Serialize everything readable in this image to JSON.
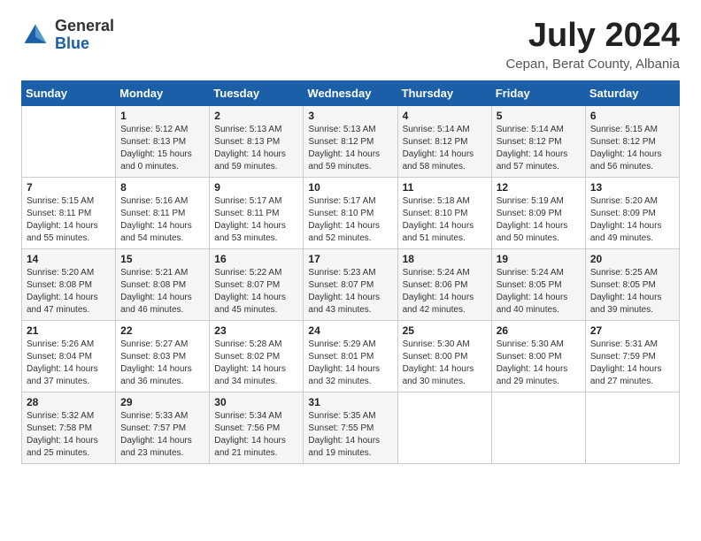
{
  "logo": {
    "general": "General",
    "blue": "Blue"
  },
  "title": {
    "month_year": "July 2024",
    "location": "Cepan, Berat County, Albania"
  },
  "weekdays": [
    "Sunday",
    "Monday",
    "Tuesday",
    "Wednesday",
    "Thursday",
    "Friday",
    "Saturday"
  ],
  "weeks": [
    [
      {
        "day": "",
        "info": ""
      },
      {
        "day": "1",
        "info": "Sunrise: 5:12 AM\nSunset: 8:13 PM\nDaylight: 15 hours\nand 0 minutes."
      },
      {
        "day": "2",
        "info": "Sunrise: 5:13 AM\nSunset: 8:13 PM\nDaylight: 14 hours\nand 59 minutes."
      },
      {
        "day": "3",
        "info": "Sunrise: 5:13 AM\nSunset: 8:12 PM\nDaylight: 14 hours\nand 59 minutes."
      },
      {
        "day": "4",
        "info": "Sunrise: 5:14 AM\nSunset: 8:12 PM\nDaylight: 14 hours\nand 58 minutes."
      },
      {
        "day": "5",
        "info": "Sunrise: 5:14 AM\nSunset: 8:12 PM\nDaylight: 14 hours\nand 57 minutes."
      },
      {
        "day": "6",
        "info": "Sunrise: 5:15 AM\nSunset: 8:12 PM\nDaylight: 14 hours\nand 56 minutes."
      }
    ],
    [
      {
        "day": "7",
        "info": "Sunrise: 5:15 AM\nSunset: 8:11 PM\nDaylight: 14 hours\nand 55 minutes."
      },
      {
        "day": "8",
        "info": "Sunrise: 5:16 AM\nSunset: 8:11 PM\nDaylight: 14 hours\nand 54 minutes."
      },
      {
        "day": "9",
        "info": "Sunrise: 5:17 AM\nSunset: 8:11 PM\nDaylight: 14 hours\nand 53 minutes."
      },
      {
        "day": "10",
        "info": "Sunrise: 5:17 AM\nSunset: 8:10 PM\nDaylight: 14 hours\nand 52 minutes."
      },
      {
        "day": "11",
        "info": "Sunrise: 5:18 AM\nSunset: 8:10 PM\nDaylight: 14 hours\nand 51 minutes."
      },
      {
        "day": "12",
        "info": "Sunrise: 5:19 AM\nSunset: 8:09 PM\nDaylight: 14 hours\nand 50 minutes."
      },
      {
        "day": "13",
        "info": "Sunrise: 5:20 AM\nSunset: 8:09 PM\nDaylight: 14 hours\nand 49 minutes."
      }
    ],
    [
      {
        "day": "14",
        "info": "Sunrise: 5:20 AM\nSunset: 8:08 PM\nDaylight: 14 hours\nand 47 minutes."
      },
      {
        "day": "15",
        "info": "Sunrise: 5:21 AM\nSunset: 8:08 PM\nDaylight: 14 hours\nand 46 minutes."
      },
      {
        "day": "16",
        "info": "Sunrise: 5:22 AM\nSunset: 8:07 PM\nDaylight: 14 hours\nand 45 minutes."
      },
      {
        "day": "17",
        "info": "Sunrise: 5:23 AM\nSunset: 8:07 PM\nDaylight: 14 hours\nand 43 minutes."
      },
      {
        "day": "18",
        "info": "Sunrise: 5:24 AM\nSunset: 8:06 PM\nDaylight: 14 hours\nand 42 minutes."
      },
      {
        "day": "19",
        "info": "Sunrise: 5:24 AM\nSunset: 8:05 PM\nDaylight: 14 hours\nand 40 minutes."
      },
      {
        "day": "20",
        "info": "Sunrise: 5:25 AM\nSunset: 8:05 PM\nDaylight: 14 hours\nand 39 minutes."
      }
    ],
    [
      {
        "day": "21",
        "info": "Sunrise: 5:26 AM\nSunset: 8:04 PM\nDaylight: 14 hours\nand 37 minutes."
      },
      {
        "day": "22",
        "info": "Sunrise: 5:27 AM\nSunset: 8:03 PM\nDaylight: 14 hours\nand 36 minutes."
      },
      {
        "day": "23",
        "info": "Sunrise: 5:28 AM\nSunset: 8:02 PM\nDaylight: 14 hours\nand 34 minutes."
      },
      {
        "day": "24",
        "info": "Sunrise: 5:29 AM\nSunset: 8:01 PM\nDaylight: 14 hours\nand 32 minutes."
      },
      {
        "day": "25",
        "info": "Sunrise: 5:30 AM\nSunset: 8:00 PM\nDaylight: 14 hours\nand 30 minutes."
      },
      {
        "day": "26",
        "info": "Sunrise: 5:30 AM\nSunset: 8:00 PM\nDaylight: 14 hours\nand 29 minutes."
      },
      {
        "day": "27",
        "info": "Sunrise: 5:31 AM\nSunset: 7:59 PM\nDaylight: 14 hours\nand 27 minutes."
      }
    ],
    [
      {
        "day": "28",
        "info": "Sunrise: 5:32 AM\nSunset: 7:58 PM\nDaylight: 14 hours\nand 25 minutes."
      },
      {
        "day": "29",
        "info": "Sunrise: 5:33 AM\nSunset: 7:57 PM\nDaylight: 14 hours\nand 23 minutes."
      },
      {
        "day": "30",
        "info": "Sunrise: 5:34 AM\nSunset: 7:56 PM\nDaylight: 14 hours\nand 21 minutes."
      },
      {
        "day": "31",
        "info": "Sunrise: 5:35 AM\nSunset: 7:55 PM\nDaylight: 14 hours\nand 19 minutes."
      },
      {
        "day": "",
        "info": ""
      },
      {
        "day": "",
        "info": ""
      },
      {
        "day": "",
        "info": ""
      }
    ]
  ]
}
